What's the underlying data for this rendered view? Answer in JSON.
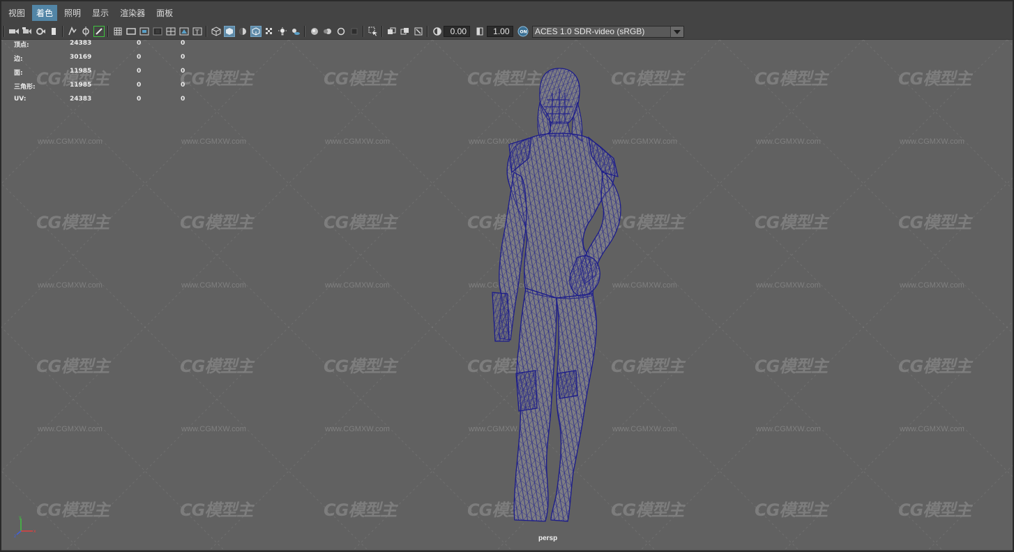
{
  "menu": {
    "items": [
      {
        "label": "视图",
        "active": false
      },
      {
        "label": "着色",
        "active": true
      },
      {
        "label": "照明",
        "active": false
      },
      {
        "label": "显示",
        "active": false
      },
      {
        "label": "渲染器",
        "active": false
      },
      {
        "label": "面板",
        "active": false
      }
    ]
  },
  "toolbar": {
    "exposure_value": "0.00",
    "gamma_value": "1.00",
    "color_space": "ACES 1.0 SDR-video (sRGB)",
    "accent_color": "#5285a6"
  },
  "hud": {
    "rows": [
      {
        "label": "顶点:",
        "a": "24383",
        "b": "0",
        "c": "0"
      },
      {
        "label": "边:",
        "a": "30169",
        "b": "0",
        "c": "0"
      },
      {
        "label": "面:",
        "a": "11985",
        "b": "0",
        "c": "0"
      },
      {
        "label": "三角形:",
        "a": "11985",
        "b": "0",
        "c": "0"
      },
      {
        "label": "UV:",
        "a": "24383",
        "b": "0",
        "c": "0"
      }
    ]
  },
  "viewport": {
    "camera": "persp",
    "wireframe_color": "#1e1e8c",
    "watermark_logo": "CG模型主",
    "watermark_url": "www.CGMXW.com"
  }
}
